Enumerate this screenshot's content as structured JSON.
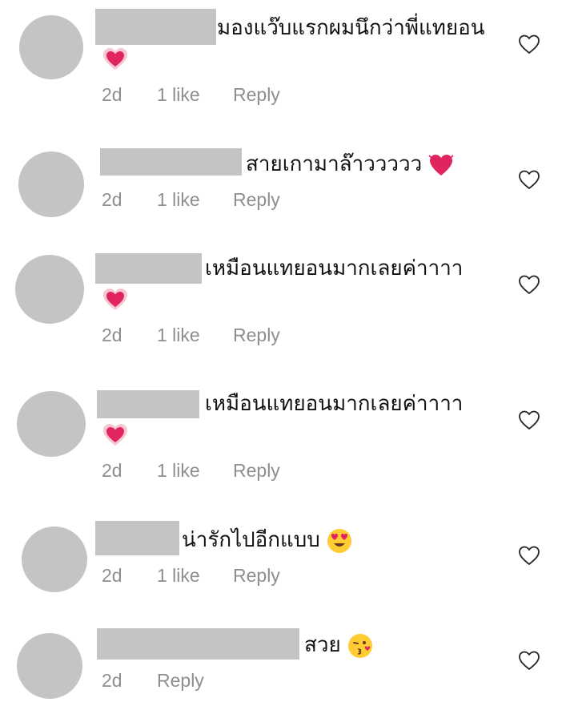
{
  "comments": [
    {
      "text": "มองแว๊บแรกผมนึกว่าพี่แทยอน",
      "emoji": "heart-glow-emoji",
      "time": "2d",
      "likes": "1 like",
      "reply": "Reply"
    },
    {
      "text": "สายเกามาล๊าววววว",
      "emoji": "heart-exclamation-emoji",
      "time": "2d",
      "likes": "1 like",
      "reply": "Reply"
    },
    {
      "text": "เหมือนแทยอนมากเลยค่าาาา",
      "emoji": "heart-glow-emoji",
      "time": "2d",
      "likes": "1 like",
      "reply": "Reply"
    },
    {
      "text": "เหมือนแทยอนมากเลยค่าาาา",
      "emoji": "heart-glow-emoji",
      "time": "2d",
      "likes": "1 like",
      "reply": "Reply"
    },
    {
      "text": "น่ารักไปอีกแบบ",
      "emoji": "heart-eyes-emoji",
      "time": "2d",
      "likes": "1 like",
      "reply": "Reply"
    },
    {
      "text": "สวย",
      "emoji": "kissing-face-emoji",
      "time": "2d",
      "likes": "",
      "reply": "Reply"
    }
  ],
  "colors": {
    "avatar": "#c4c4c4",
    "meta": "#8e8e8e",
    "heart_outline": "#262626",
    "emoji_red": "#e0245e"
  },
  "icons": {
    "like": "heart-outline-icon"
  }
}
